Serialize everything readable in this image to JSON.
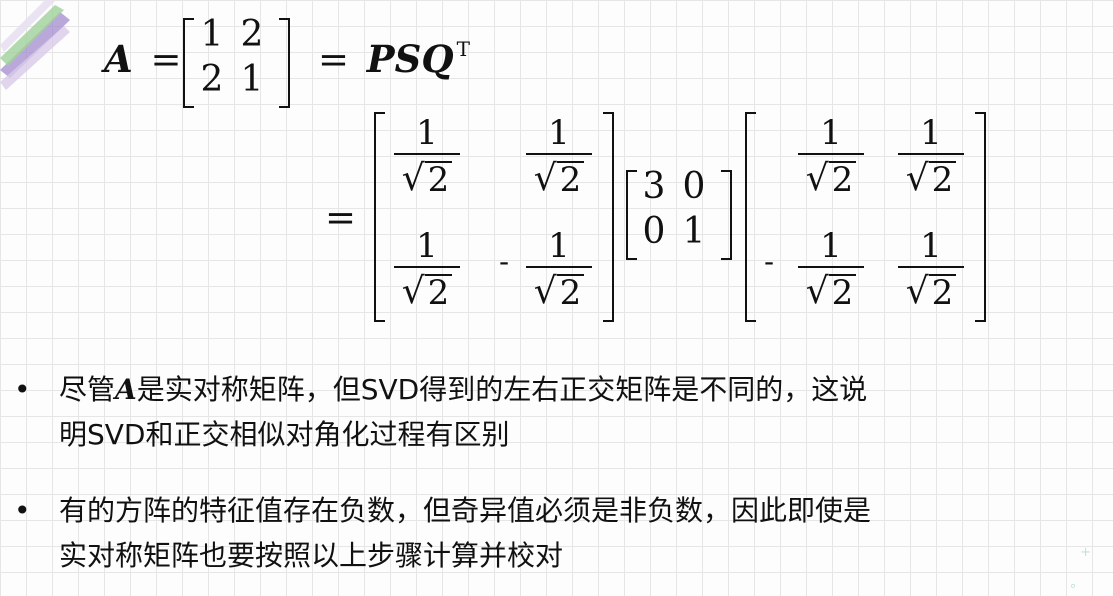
{
  "colors": {
    "text": "#111111",
    "grid": "#e6e6e6",
    "background": "#fdfdfd",
    "deco_purple": "#9b83c9",
    "deco_green": "#9fd19a",
    "sparkle": "#bfe3e0"
  },
  "equation": {
    "line1": {
      "lhs_symbol": "A",
      "eq": "=",
      "rhs_symbol": "PSQ",
      "transpose": "T"
    },
    "matrix_A": [
      [
        "1",
        "2"
      ],
      [
        "2",
        "1"
      ]
    ],
    "eq2": "=",
    "P": {
      "r1c1": {
        "num": "1",
        "rad": "2"
      },
      "r1c2": {
        "num": "1",
        "rad": "2"
      },
      "r2c1": {
        "num": "1",
        "rad": "2"
      },
      "r2c2": {
        "sign": "-",
        "num": "1",
        "rad": "2"
      }
    },
    "S": [
      [
        "3",
        "0"
      ],
      [
        "0",
        "1"
      ]
    ],
    "QT": {
      "r1c1": {
        "num": "1",
        "rad": "2"
      },
      "r1c2": {
        "num": "1",
        "rad": "2"
      },
      "r2c1": {
        "sign": "-",
        "num": "1",
        "rad": "2"
      },
      "r2c2": {
        "num": "1",
        "rad": "2"
      }
    },
    "sqrt_symbol": "√"
  },
  "bullets": [
    {
      "marker": "•",
      "pre": "尽管",
      "symbol": "A",
      "line1": "是实对称矩阵，但SVD得到的左右正交矩阵是不同的，这说",
      "line2": "明SVD和正交相似对角化过程有区别"
    },
    {
      "marker": "•",
      "line1": "有的方阵的特征值存在负数，但奇异值必须是非负数，因此即使是",
      "line2": "实对称矩阵也要按照以上步骤计算并校对"
    }
  ],
  "decor": {
    "sparkle1": "+",
    "sparkle2": "∘"
  }
}
